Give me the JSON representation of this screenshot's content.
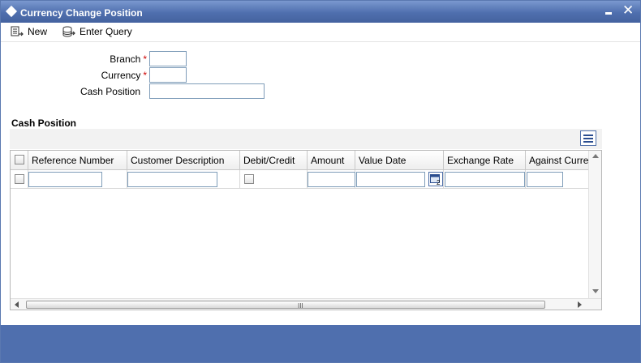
{
  "window": {
    "title": "Currency Change Position"
  },
  "toolbar": {
    "new_label": "New",
    "enter_query_label": "Enter Query"
  },
  "form": {
    "branch": {
      "label": "Branch",
      "required": "*",
      "value": ""
    },
    "currency": {
      "label": "Currency",
      "required": "*",
      "value": ""
    },
    "cash_position": {
      "label": "Cash Position",
      "value": ""
    }
  },
  "grid": {
    "title": "Cash Position",
    "columns": [
      "Reference Number",
      "Customer Description",
      "Debit/Credit",
      "Amount",
      "Value Date",
      "Exchange Rate",
      "Against Curre"
    ],
    "rows": [
      {
        "reference_number": "",
        "customer_description": "",
        "amount": "",
        "value_date": "",
        "exchange_rate": "",
        "against_currency": ""
      }
    ],
    "scrollbar_grip": "III"
  },
  "colors": {
    "titlebar": "#4f6fae",
    "required": "#cc0000",
    "footer": "#4f6fae"
  }
}
